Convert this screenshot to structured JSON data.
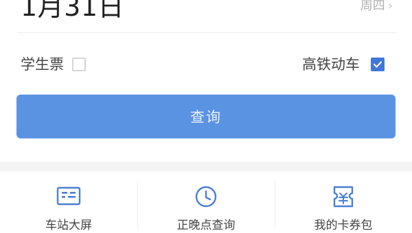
{
  "search": {
    "date": "1月31日",
    "weekday": "周四",
    "weekday_chevron": "›"
  },
  "options": {
    "student_label": "学生票",
    "student_checked": false,
    "highspeed_label": "高铁动车",
    "highspeed_checked": true
  },
  "query_button": {
    "label": "查询"
  },
  "bottom_nav": {
    "items": [
      {
        "label": "车站大屏",
        "icon": "station-screen-icon"
      },
      {
        "label": "正晚点查询",
        "icon": "clock-icon"
      },
      {
        "label": "我的卡券包",
        "icon": "ticket-icon"
      }
    ]
  },
  "colors": {
    "accent": "#3f78d6",
    "button": "#5b93e3",
    "icon": "#4a7fd4"
  }
}
